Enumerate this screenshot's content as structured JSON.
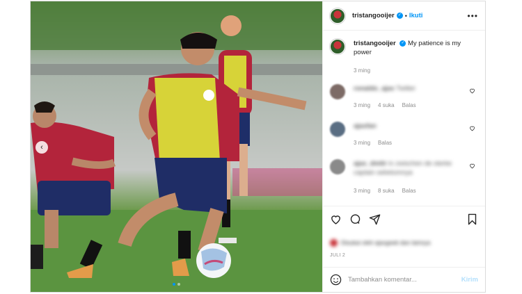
{
  "post": {
    "username": "tristangooijer",
    "follow_label": "Ikuti",
    "more_label": "•••",
    "caption": "My patience is my power",
    "caption_time": "3 ming"
  },
  "comments": [
    {
      "name": "ronaldo_ajax",
      "text": "Twitter",
      "time": "3 ming",
      "likes": "4 suka",
      "reply": "Balas"
    },
    {
      "name": "ajaxfan",
      "text": "",
      "time": "3 ming",
      "likes": "",
      "reply": "Balas"
    },
    {
      "name": "ajax_dmitr",
      "text": "in zwischen de sterke captain sebelumnya",
      "time": "3 ming",
      "likes": "8 suka",
      "reply": "Balas"
    }
  ],
  "likes_text": "Disukai oleh ajaxgeek dan lainnya",
  "date": "JULI 2",
  "add_comment_placeholder": "Tambahkan komentar...",
  "send_label": "Kirim",
  "colors": {
    "accent": "#0095f6",
    "muted": "#8e8e8e"
  },
  "icons": [
    "heart-icon",
    "comment-icon",
    "share-icon",
    "bookmark-icon",
    "emoji-icon",
    "verified-icon",
    "carousel-prev-icon"
  ]
}
